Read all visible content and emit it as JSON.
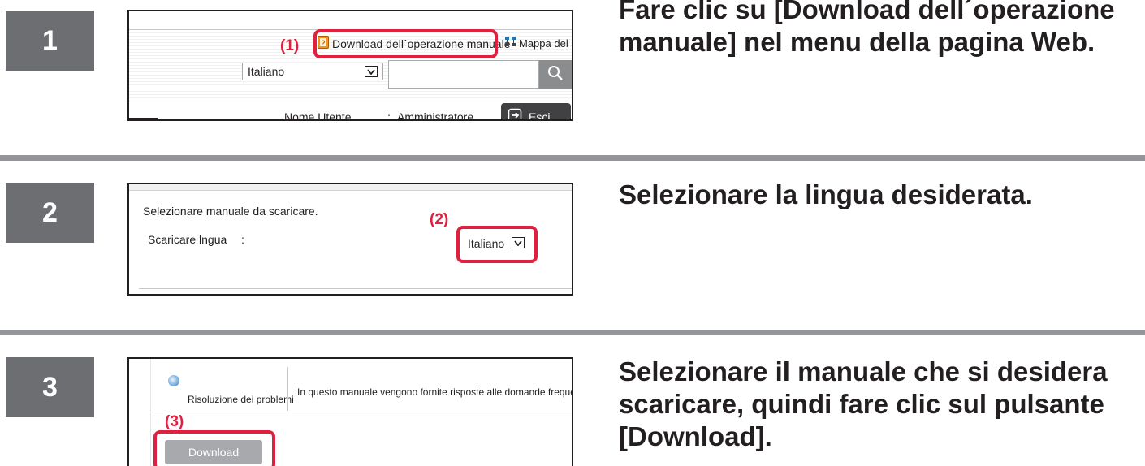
{
  "steps": [
    {
      "number": "1",
      "instruction": "Fare clic su [Download dell´operazione manuale] nel menu della pagina Web.",
      "screenshot": {
        "callout": "(1)",
        "download_link": "Download dell´operazione manuale",
        "sitemap_link": "Mappa del sito",
        "language_select": "Italiano",
        "search_placeholder": "",
        "user_label": "Nome Utente",
        "user_colon": ":",
        "user_value": "Amministratore",
        "logout_button": "Esci"
      }
    },
    {
      "number": "2",
      "instruction": "Selezionare la lingua desiderata.",
      "screenshot": {
        "callout": "(2)",
        "heading": "Selezionare manuale da scaricare.",
        "language_label": "Scaricare lngua",
        "language_colon": ":",
        "language_select": "Italiano"
      }
    },
    {
      "number": "3",
      "instruction": "Selezionare il manuale che si desidera scaricare, quindi fare clic sul pulsante [Download].",
      "screenshot": {
        "callout": "(3)",
        "manual_title": "Risoluzione dei problemi",
        "manual_description": "In questo manuale vengono fornite risposte alle domande frequenti rela",
        "download_button": "Download"
      }
    }
  ],
  "colors": {
    "badge": "#6d6e71",
    "divider": "#939598",
    "callout": "#e0203f",
    "instruction_text": "#231f20"
  },
  "icons": [
    "manual-book-icon",
    "sitemap-icon",
    "search-icon",
    "select-arrow-icon",
    "logout-icon",
    "manual-bullet-icon"
  ]
}
